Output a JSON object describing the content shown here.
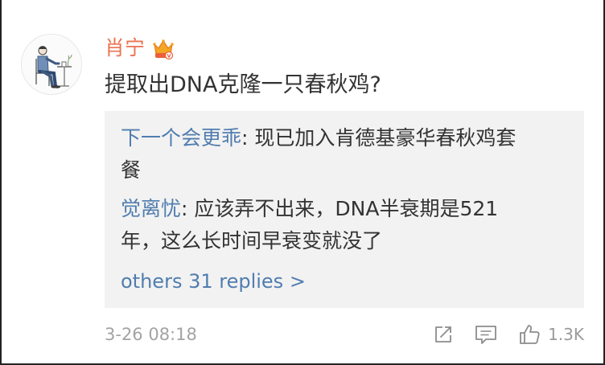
{
  "comment": {
    "username": "肖宁",
    "badge_icon": "vip-crown-icon",
    "text": "提取出DNA克隆一只春秋鸡?",
    "timestamp": "3-26 08:18",
    "like_count": "1.3K"
  },
  "replies": [
    {
      "author": "下一个会更乖",
      "separator": ": ",
      "lines": [
        "现已加入肯德基豪华春秋鸡套",
        "餐"
      ]
    },
    {
      "author": "觉离忧",
      "separator": ": ",
      "lines": [
        "应该弄不出来，DNA半衰期是521",
        "年，这么长时间早衰变就没了"
      ]
    }
  ],
  "more_replies": "others 31 replies >",
  "actions": [
    {
      "icon": "share-icon"
    },
    {
      "icon": "comment-icon"
    },
    {
      "icon": "thumbs-up-icon"
    }
  ],
  "colors": {
    "username": "#eb7350",
    "link": "#507daf",
    "text": "#333333",
    "meta": "#a3a3a3",
    "reply_bg": "#f2f2f2"
  }
}
